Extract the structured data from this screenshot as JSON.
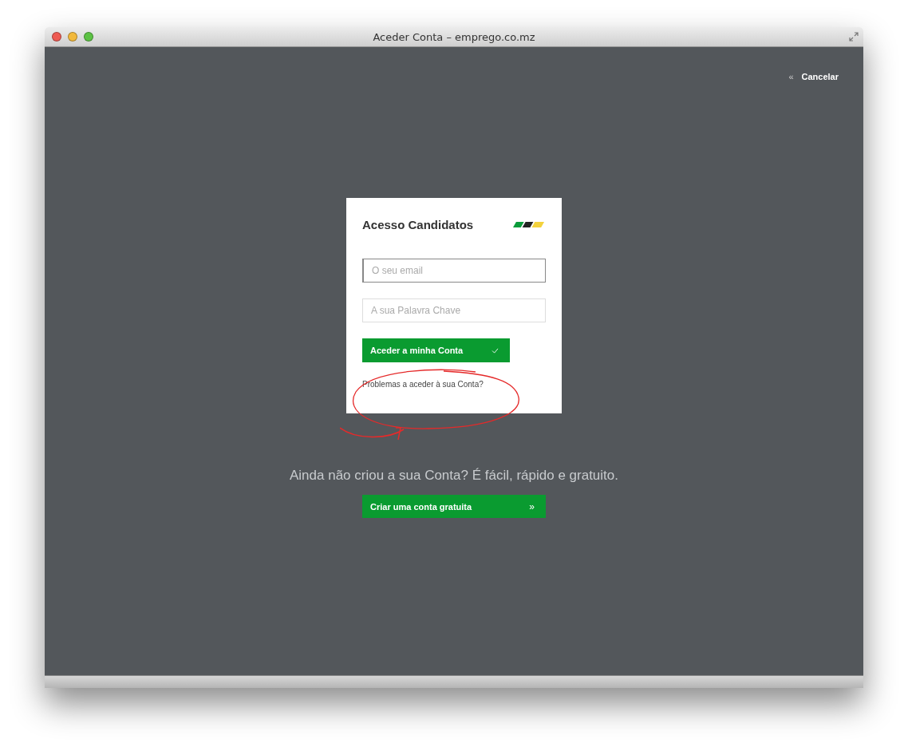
{
  "window": {
    "title": "Aceder Conta – emprego.co.mz"
  },
  "cancel": {
    "icon": "«",
    "label": "Cancelar"
  },
  "login_card": {
    "title": "Acesso Candidatos",
    "fields": [
      {
        "placeholder": "O seu email",
        "focused": true
      },
      {
        "placeholder": "A sua Palavra Chave",
        "focused": false
      }
    ],
    "submit": {
      "label": "Aceder a minha Conta"
    },
    "help_link": "Problemas a aceder à sua Conta?",
    "annotated": true
  },
  "signup": {
    "tagline": "Ainda não criou a sua Conta? É fácil, rápido e gratuito.",
    "button": {
      "label": "Criar uma conta gratuita",
      "icon": "»"
    }
  }
}
